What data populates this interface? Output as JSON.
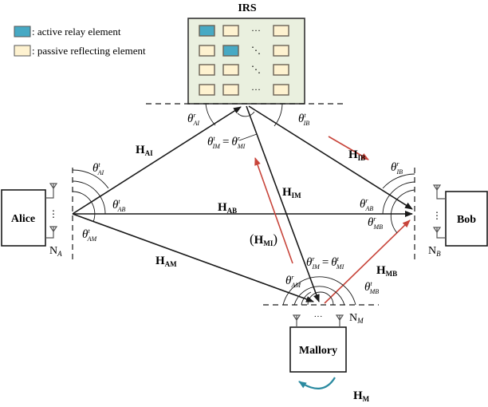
{
  "legend": {
    "active_label": ": active relay element",
    "passive_label": ": passive reflecting element"
  },
  "colors": {
    "active_element": "#47a9c4",
    "passive_element": "#fef2d0",
    "irs_panel": "#eaf0df",
    "signal_red": "#c8453b",
    "self_loop_teal": "#2a8aa0"
  },
  "irs": {
    "title": "IRS",
    "grid": [
      [
        "active",
        "passive",
        "hdots",
        "passive"
      ],
      [
        "passive",
        "active",
        "ddots",
        "passive"
      ],
      [
        "passive",
        "passive",
        "ddots",
        "passive"
      ],
      [
        "passive",
        "passive",
        "hdots",
        "passive"
      ]
    ]
  },
  "nodes": {
    "alice": {
      "label": "Alice",
      "antennas": "N",
      "antennas_sub": "A"
    },
    "bob": {
      "label": "Bob",
      "antennas": "N",
      "antennas_sub": "B"
    },
    "mallory": {
      "label": "Mallory",
      "antennas": "N",
      "antennas_sub": "M"
    }
  },
  "channels": {
    "H_AI": {
      "main": "H",
      "sub": "AI"
    },
    "H_AB": {
      "main": "H",
      "sub": "AB"
    },
    "H_AM": {
      "main": "H",
      "sub": "AM"
    },
    "H_IB": {
      "main": "H",
      "sub": "IB"
    },
    "H_IM": {
      "main": "H",
      "sub": "IM"
    },
    "H_MI": {
      "main": "H",
      "sub": "MI",
      "paren_open": "(",
      "paren_close": ")"
    },
    "H_MB": {
      "main": "H",
      "sub": "MB"
    },
    "H_M": {
      "main": "H",
      "sub": "M"
    }
  },
  "angles": {
    "t_AI_alice": {
      "sup": "t",
      "sub": "AI"
    },
    "t_AB": {
      "sup": "t",
      "sub": "AB"
    },
    "t_AM": {
      "sup": "t",
      "sub": "AM"
    },
    "r_AI": {
      "sup": "r",
      "sub": "AI"
    },
    "t_IB": {
      "sup": "t",
      "sub": "IB"
    },
    "eq_IRS": {
      "left_sup": "t",
      "left_sub": "IM",
      "eq": "=",
      "right_sup": "r",
      "right_sub": "MI"
    },
    "r_IB": {
      "sup": "r",
      "sub": "IB"
    },
    "r_AB": {
      "sup": "r",
      "sub": "AB"
    },
    "r_MB": {
      "sup": "r",
      "sub": "MB"
    },
    "r_AM": {
      "sup": "r",
      "sub": "AM"
    },
    "t_MB": {
      "sup": "t",
      "sub": "MB"
    },
    "eq_Mallory": {
      "left_sup": "r",
      "left_sub": "IM",
      "eq": "=",
      "right_sup": "t",
      "right_sub": "MI"
    }
  },
  "symbols": {
    "theta": "θ",
    "vdots": "⋮",
    "hdots": "···"
  }
}
